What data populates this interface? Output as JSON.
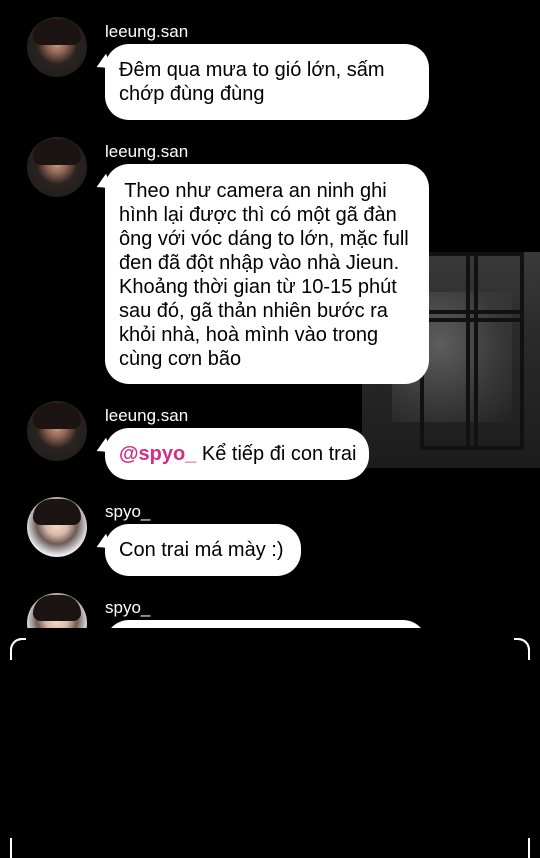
{
  "messages": [
    {
      "user": "leeung.san",
      "avatar": "avatar-san",
      "text_lines": [
        "Đêm qua mưa to gió lớn, sấm",
        "chớp đùng đùng"
      ]
    },
    {
      "user": "leeung.san",
      "avatar": "avatar-san",
      "text_lines": [
        " Theo như camera an ninh ghi",
        "hình lại được thì có một gã đàn",
        "ông với vóc dáng to lớn, mặc full",
        "đen đã đột nhập vào nhà Jieun.",
        "Khoảng thời gian từ 10-15 phút",
        "sau đó, gã thản nhiên bước ra",
        "khỏi nhà, hoà mình vào trong",
        "cùng cơn bão"
      ]
    },
    {
      "user": "leeung.san",
      "avatar": "avatar-san",
      "mention": "@spyo_",
      "text": "Kể tiếp đi con trai"
    },
    {
      "user": "spyo_",
      "avatar": "avatar-spyo",
      "text": "Con trai má mày :)"
    },
    {
      "user": "spyo_",
      "avatar": "avatar-spyo",
      "text": ""
    }
  ],
  "colors": {
    "background": "#000000",
    "bubble": "#ffffff",
    "mention": "#d22e86",
    "text": "#000000",
    "username": "#ffffff"
  }
}
